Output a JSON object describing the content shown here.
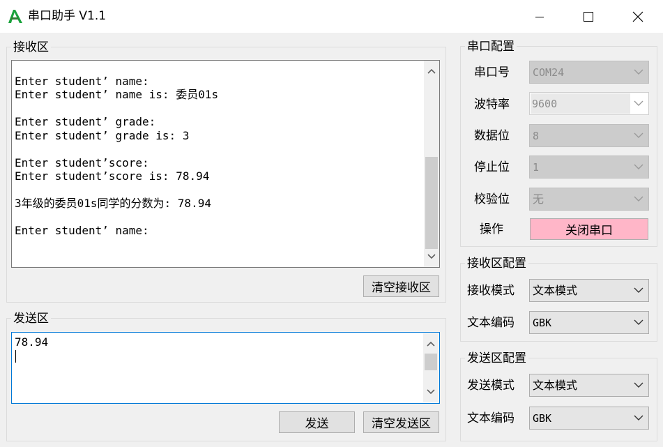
{
  "window": {
    "title": "串口助手 V1.1"
  },
  "receive_area": {
    "title": "接收区",
    "text": "\nEnter student’ name:\nEnter student’ name is: 委员01s\n\nEnter student’ grade:\nEnter student’ grade is: 3\n\nEnter student’score:\nEnter student’score is: 78.94\n\n3年级的委员01s同学的分数为: 78.94\n\nEnter student’ name:",
    "clear_button": "清空接收区"
  },
  "send_area": {
    "title": "发送区",
    "text": "78.94",
    "send_button": "发送",
    "clear_button": "清空发送区"
  },
  "serial_config": {
    "title": "串口配置",
    "port_label": "串口号",
    "port_value": "COM24",
    "baud_label": "波特率",
    "baud_value": "9600",
    "databits_label": "数据位",
    "databits_value": "8",
    "stopbits_label": "停止位",
    "stopbits_value": "1",
    "parity_label": "校验位",
    "parity_value": "无",
    "action_label": "操作",
    "action_button": "关闭串口"
  },
  "receive_config": {
    "title": "接收区配置",
    "mode_label": "接收模式",
    "mode_value": "文本模式",
    "encoding_label": "文本编码",
    "encoding_value": "GBK"
  },
  "send_config": {
    "title": "发送区配置",
    "mode_label": "发送模式",
    "mode_value": "文本模式",
    "encoding_label": "文本编码",
    "encoding_value": "GBK"
  },
  "colors": {
    "accent": "#0078d7",
    "close_button_bg": "#ffb6c8",
    "app_icon": "#1aa33c"
  },
  "icons": {
    "app": "app-logo-icon",
    "minimize": "minimize-icon",
    "maximize": "maximize-icon",
    "close": "close-icon",
    "scroll_up": "chevron-up-icon",
    "scroll_down": "chevron-down-icon",
    "dropdown": "chevron-down-icon"
  }
}
